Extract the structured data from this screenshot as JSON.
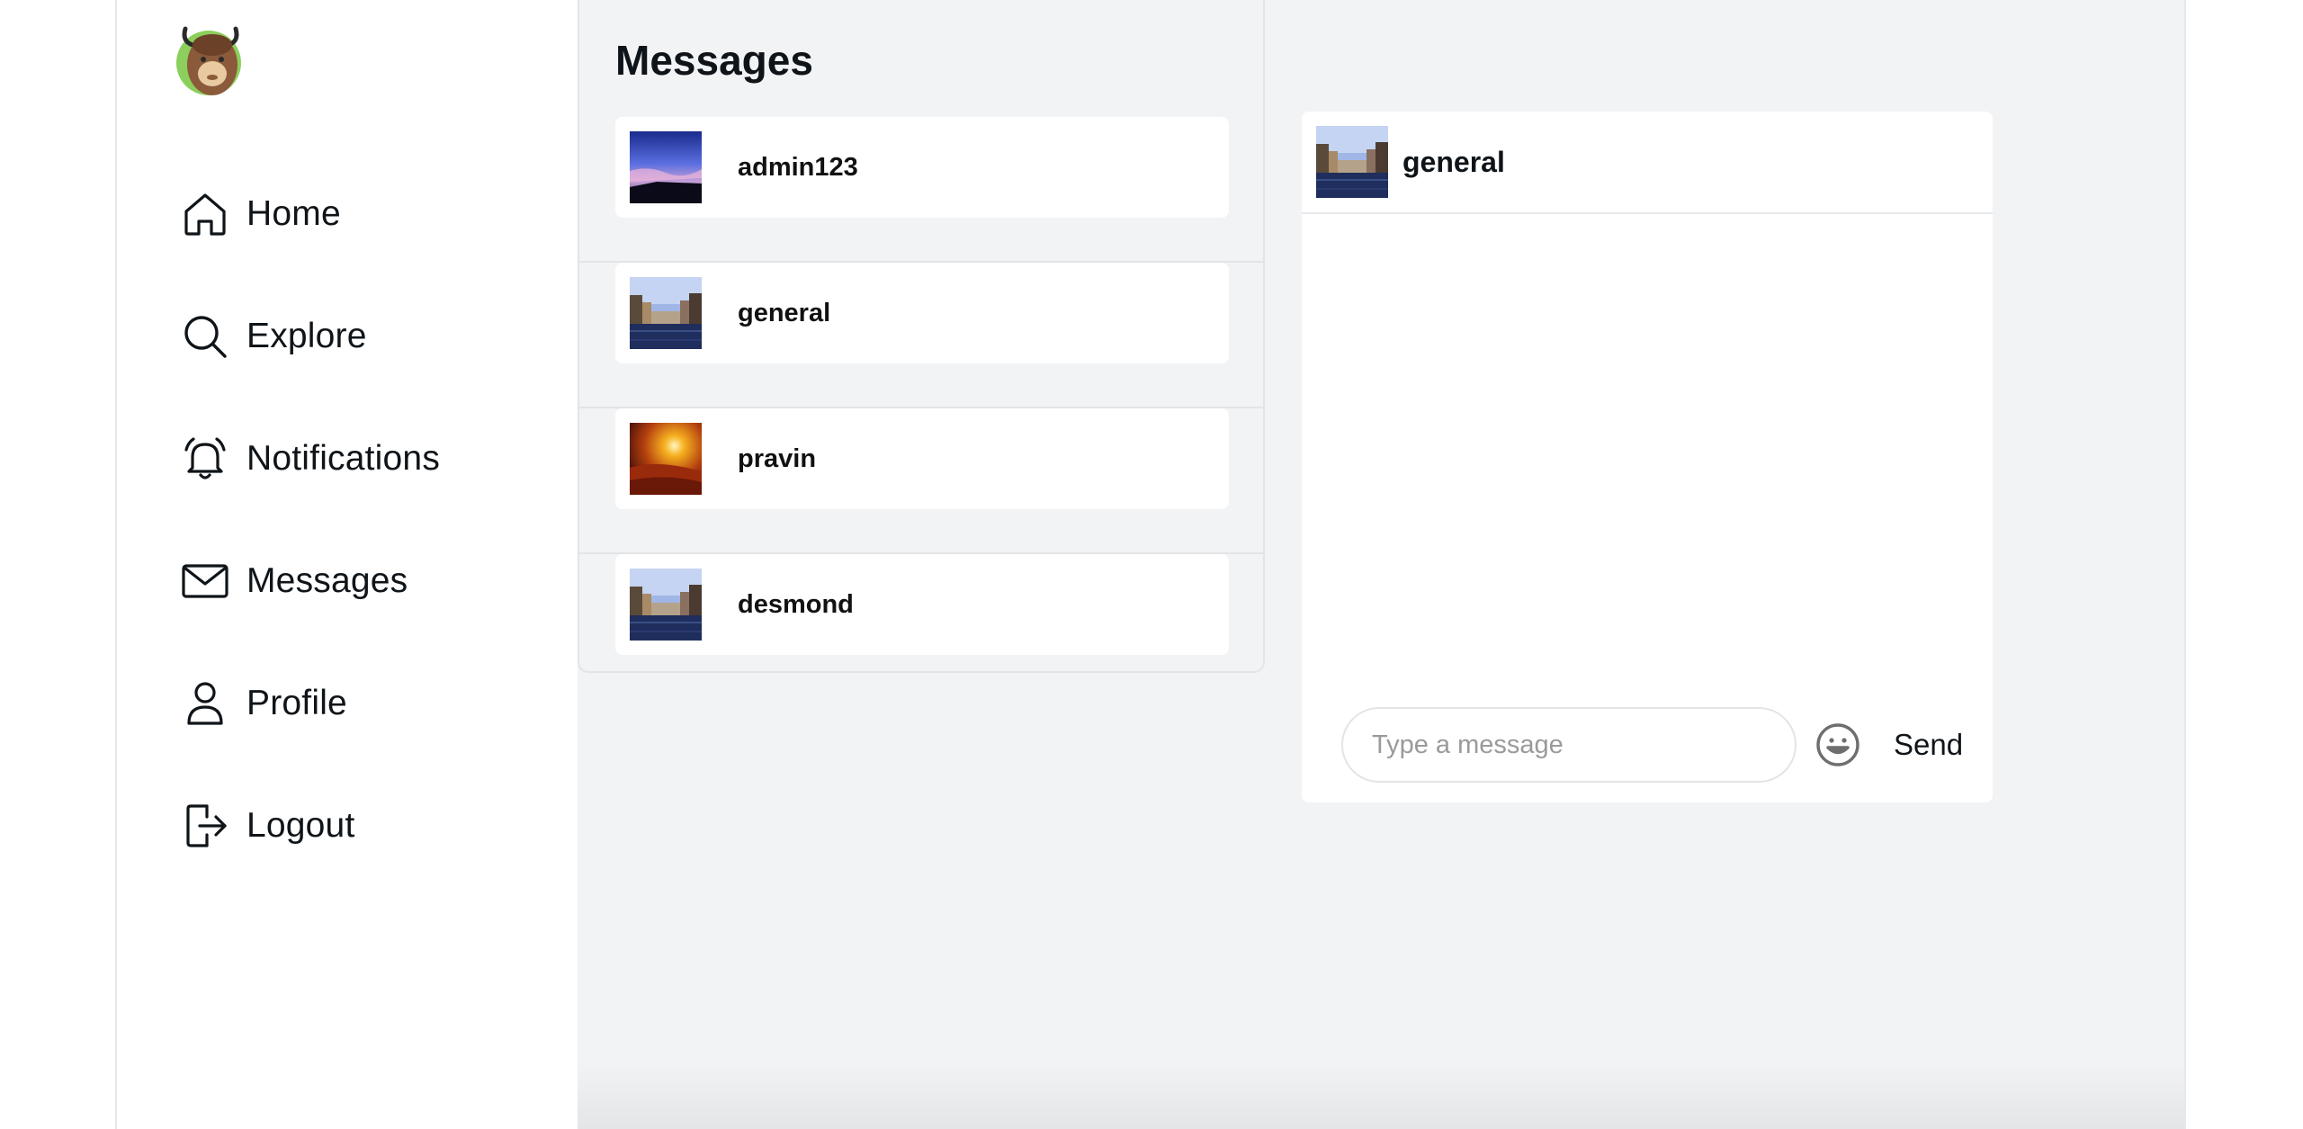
{
  "brand": {
    "logo_icon": "bison-logo-icon"
  },
  "sidebar": {
    "items": [
      {
        "label": "Home",
        "icon": "home-icon"
      },
      {
        "label": "Explore",
        "icon": "search-icon"
      },
      {
        "label": "Notifications",
        "icon": "bell-icon"
      },
      {
        "label": "Messages",
        "icon": "mail-icon"
      },
      {
        "label": "Profile",
        "icon": "user-icon"
      },
      {
        "label": "Logout",
        "icon": "logout-icon"
      }
    ]
  },
  "conversations": {
    "title": "Messages",
    "items": [
      {
        "name": "admin123",
        "avatar": "sunset-sky-avatar"
      },
      {
        "name": "general",
        "avatar": "canal-city-avatar"
      },
      {
        "name": "pravin",
        "avatar": "desert-sun-avatar"
      },
      {
        "name": "desmond",
        "avatar": "canal-city-avatar"
      }
    ]
  },
  "chat": {
    "title": "general",
    "avatar": "canal-city-avatar",
    "input_placeholder": "Type a message",
    "emoji_icon": "smiley-icon",
    "send_label": "Send"
  },
  "colors": {
    "main_bg": "#f2f3f5",
    "card_bg": "#ffffff",
    "text": "#0f1419",
    "border": "#e2e4e7"
  }
}
